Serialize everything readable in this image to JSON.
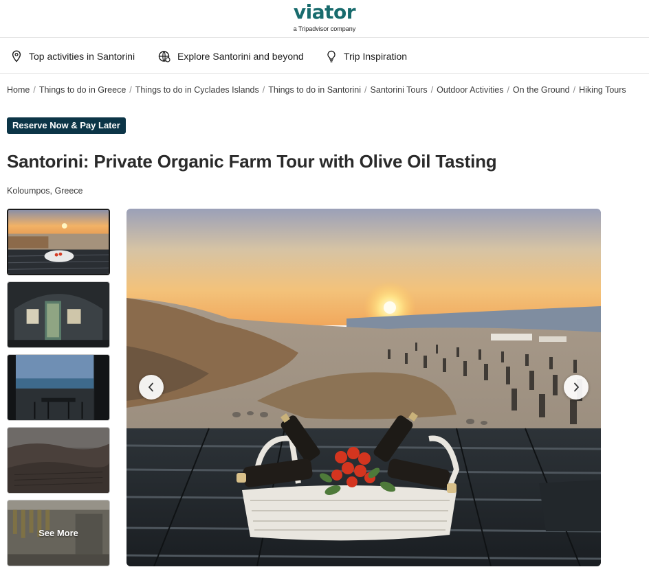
{
  "header": {
    "logo_text": "viator",
    "logo_tagline": "a Tripadvisor company",
    "brand_color": "#186b6d"
  },
  "nav": {
    "items": [
      {
        "label": "Top activities in Santorini",
        "icon": "map-pin-icon"
      },
      {
        "label": "Explore Santorini and beyond",
        "icon": "globe-icon"
      },
      {
        "label": "Trip Inspiration",
        "icon": "lightbulb-icon"
      }
    ]
  },
  "breadcrumb": [
    "Home",
    "Things to do in Greece",
    "Things to do in Cyclades Islands",
    "Things to do in Santorini",
    "Santorini Tours",
    "Outdoor Activities",
    "On the Ground",
    "Hiking Tours"
  ],
  "badge": {
    "label": "Reserve Now & Pay Later",
    "color": "#0c3547"
  },
  "product": {
    "title": "Santorini: Private Organic Farm Tour with Olive Oil Tasting",
    "location": "Koloumpos, Greece"
  },
  "gallery": {
    "see_more_label": "See More",
    "prev_icon": "chevron-left-icon",
    "next_icon": "chevron-right-icon"
  }
}
